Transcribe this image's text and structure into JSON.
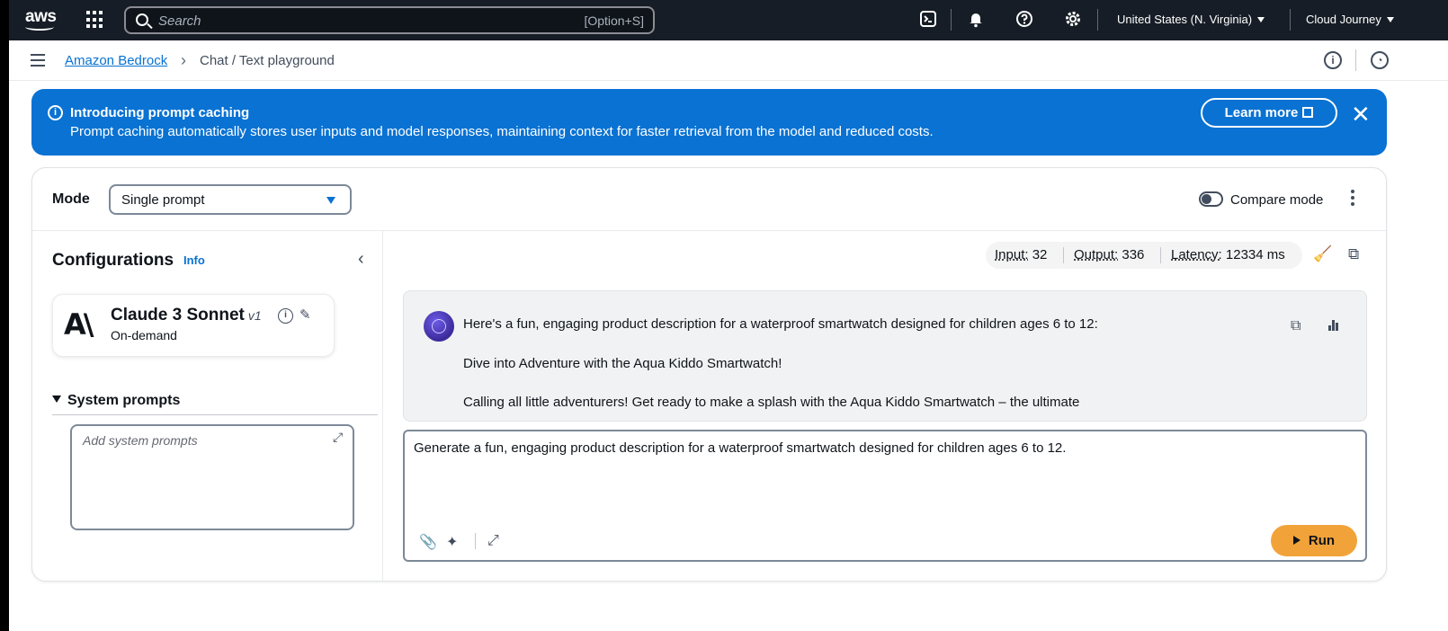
{
  "topnav": {
    "logo_text": "aws",
    "search_placeholder": "Search",
    "search_shortcut": "[Option+S]",
    "region": "United States (N. Virginia)",
    "account": "Cloud Journey",
    "icons": [
      "cloudshell-icon",
      "bell-icon",
      "help-icon",
      "settings-icon"
    ]
  },
  "breadcrumb": {
    "service": "Amazon Bedrock",
    "current": "Chat / Text playground"
  },
  "banner": {
    "title": "Introducing prompt caching",
    "body": "Prompt caching automatically stores user inputs and model responses, maintaining context for faster retrieval from the model and reduced costs.",
    "learn_more": "Learn more",
    "color": "#0972d3"
  },
  "mode": {
    "label": "Mode",
    "selected": "Single prompt",
    "compare_label": "Compare mode",
    "compare_enabled": false
  },
  "config": {
    "title": "Configurations",
    "info_link": "Info",
    "model": {
      "name": "Claude 3 Sonnet",
      "version": "v1",
      "throughput": "On-demand"
    },
    "system_prompts_label": "System prompts",
    "system_prompts_placeholder": "Add system prompts"
  },
  "metrics": {
    "input_label": "Input:",
    "input_value": "32",
    "output_label": "Output:",
    "output_value": "336",
    "latency_label": "Latency:",
    "latency_value": "12334 ms"
  },
  "response": {
    "lines": [
      "Here's a fun, engaging product description for a waterproof smartwatch designed for children ages 6 to 12:",
      "Dive into Adventure with the Aqua Kiddo Smartwatch!",
      "Calling all little adventurers! Get ready to make a splash with the Aqua Kiddo Smartwatch – the ultimate"
    ]
  },
  "prompt": {
    "text": "Generate a fun, engaging product description for a waterproof smartwatch designed for children ages 6 to 12.",
    "run_label": "Run",
    "run_color": "#f1a33a"
  }
}
